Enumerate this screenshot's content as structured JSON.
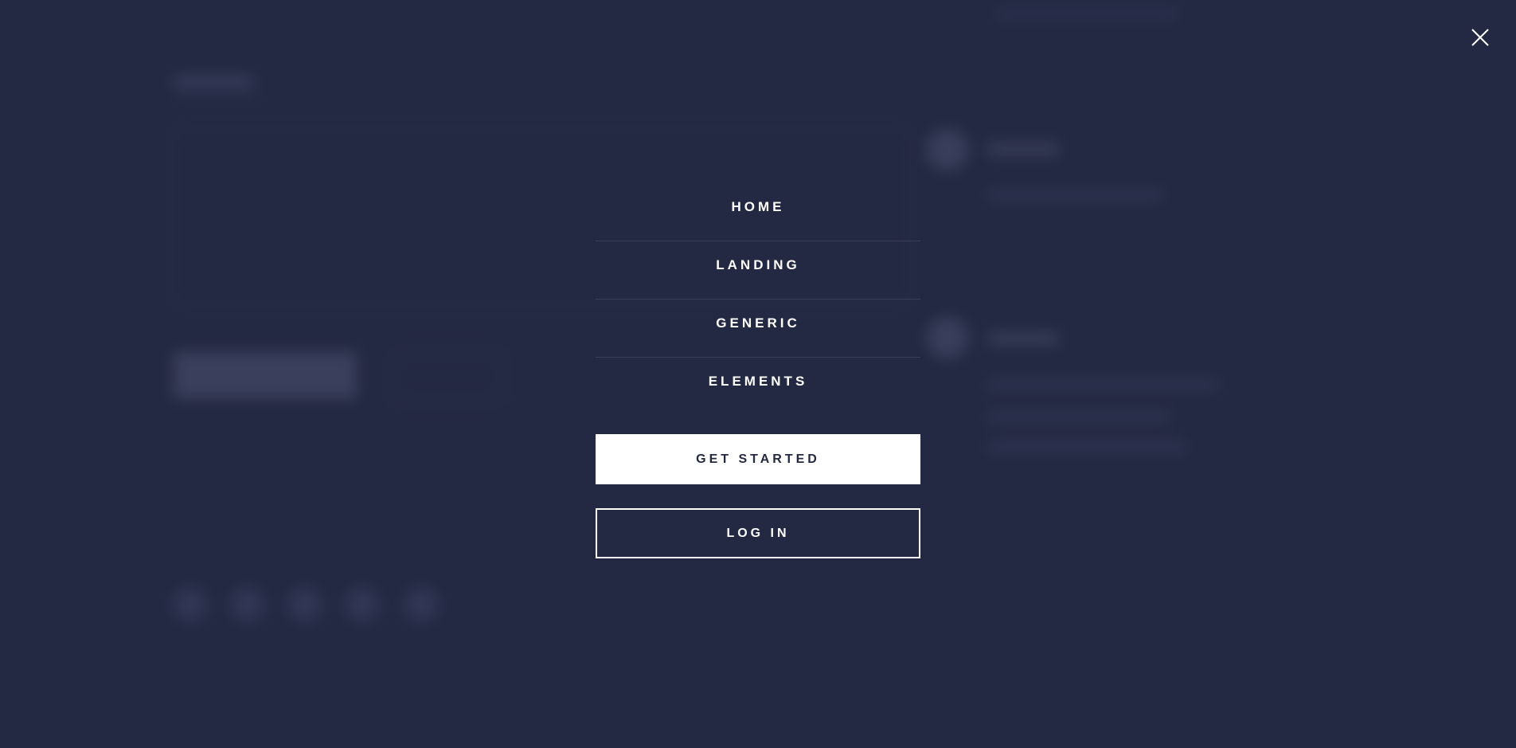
{
  "menu": {
    "links": [
      {
        "label": "HOME"
      },
      {
        "label": "LANDING"
      },
      {
        "label": "GENERIC"
      },
      {
        "label": "ELEMENTS"
      }
    ],
    "primary_button": "GET STARTED",
    "secondary_button": "LOG IN"
  },
  "icons": {
    "close": "close-icon"
  },
  "colors": {
    "background": "#242943",
    "text": "#ffffff",
    "primary_button_bg": "#ffffff",
    "primary_button_text": "#242943",
    "divider": "rgba(255,255,255,0.10)"
  }
}
